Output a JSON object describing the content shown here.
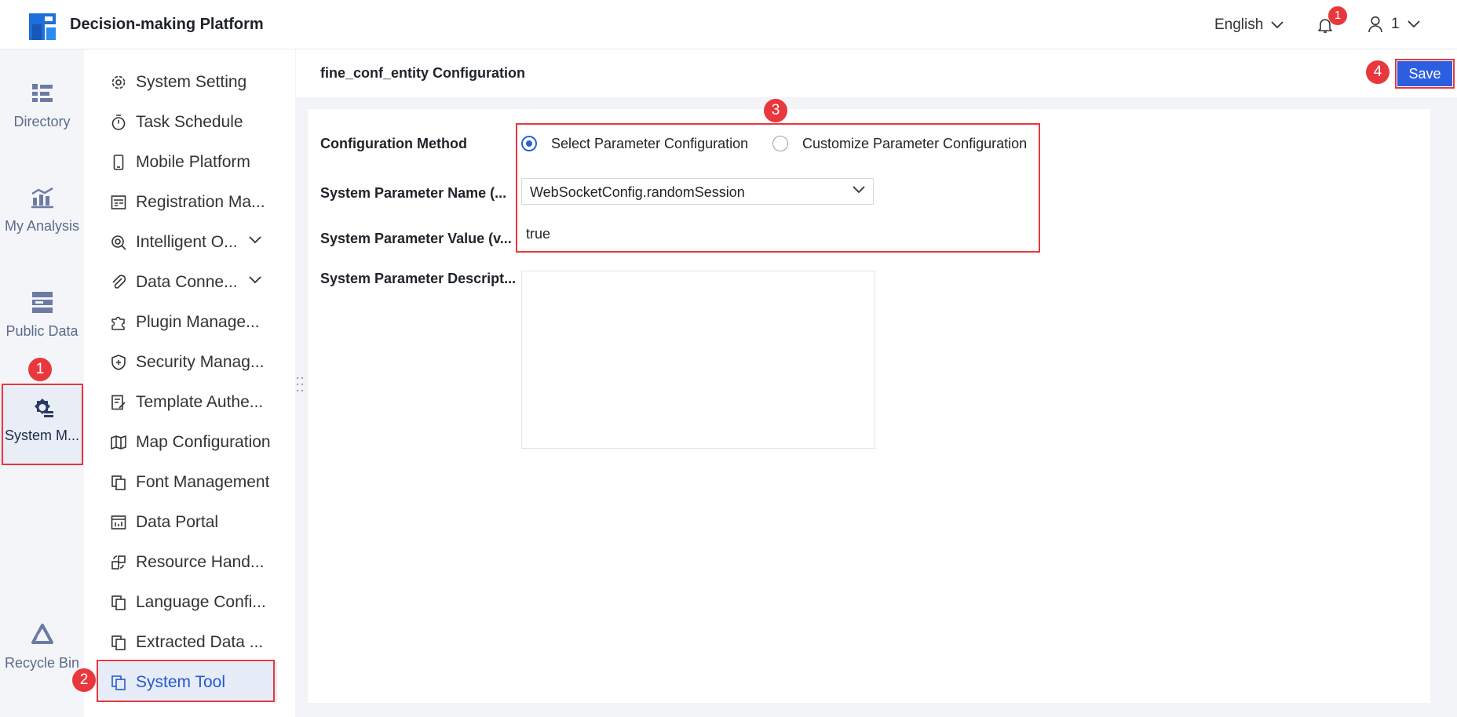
{
  "header": {
    "app_title": "Decision-making Platform",
    "language": "English",
    "notification_count": "1",
    "user_name": "1"
  },
  "rail": {
    "items": [
      {
        "label": "Directory",
        "icon": "directory-icon"
      },
      {
        "label": "My Analysis",
        "icon": "analysis-chart-icon"
      },
      {
        "label": "Public Data",
        "icon": "public-data-icon"
      },
      {
        "label": "System M...",
        "icon": "system-management-gear-icon"
      },
      {
        "label": "Recycle Bin",
        "icon": "recycle-bin-icon"
      }
    ],
    "active_index": 3
  },
  "menu": {
    "items": [
      {
        "label": "System Setting"
      },
      {
        "label": "Task Schedule"
      },
      {
        "label": "Mobile Platform"
      },
      {
        "label": "Registration Ma..."
      },
      {
        "label": "Intelligent O...",
        "expandable": true
      },
      {
        "label": "Data Conne...",
        "expandable": true
      },
      {
        "label": "Plugin Manage..."
      },
      {
        "label": "Security Manag..."
      },
      {
        "label": "Template Authe..."
      },
      {
        "label": "Map Configuration"
      },
      {
        "label": "Font Management"
      },
      {
        "label": "Data Portal"
      },
      {
        "label": "Resource Hand..."
      },
      {
        "label": "Language Confi..."
      },
      {
        "label": "Extracted Data ..."
      },
      {
        "label": "System Tool"
      }
    ],
    "selected_index": 15
  },
  "main": {
    "title": "fine_conf_entity Configuration",
    "save_label": "Save",
    "form": {
      "config_method_label": "Configuration Method",
      "option_select": "Select Parameter Configuration",
      "option_customize": "Customize Parameter Configuration",
      "selected_option": "select",
      "param_name_label": "System Parameter Name  (...",
      "param_name_value": "WebSocketConfig.randomSession",
      "param_value_label": "System Parameter Value (v...",
      "param_value_value": "true",
      "param_desc_label": "System Parameter Descript...",
      "param_desc_value": ""
    }
  },
  "annotations": {
    "markers": [
      "1",
      "2",
      "3",
      "4"
    ],
    "color": "#e8383d"
  },
  "colors": {
    "primary": "#2c5fe0",
    "selected_text": "#2659cc",
    "annotation": "#e8383d"
  }
}
